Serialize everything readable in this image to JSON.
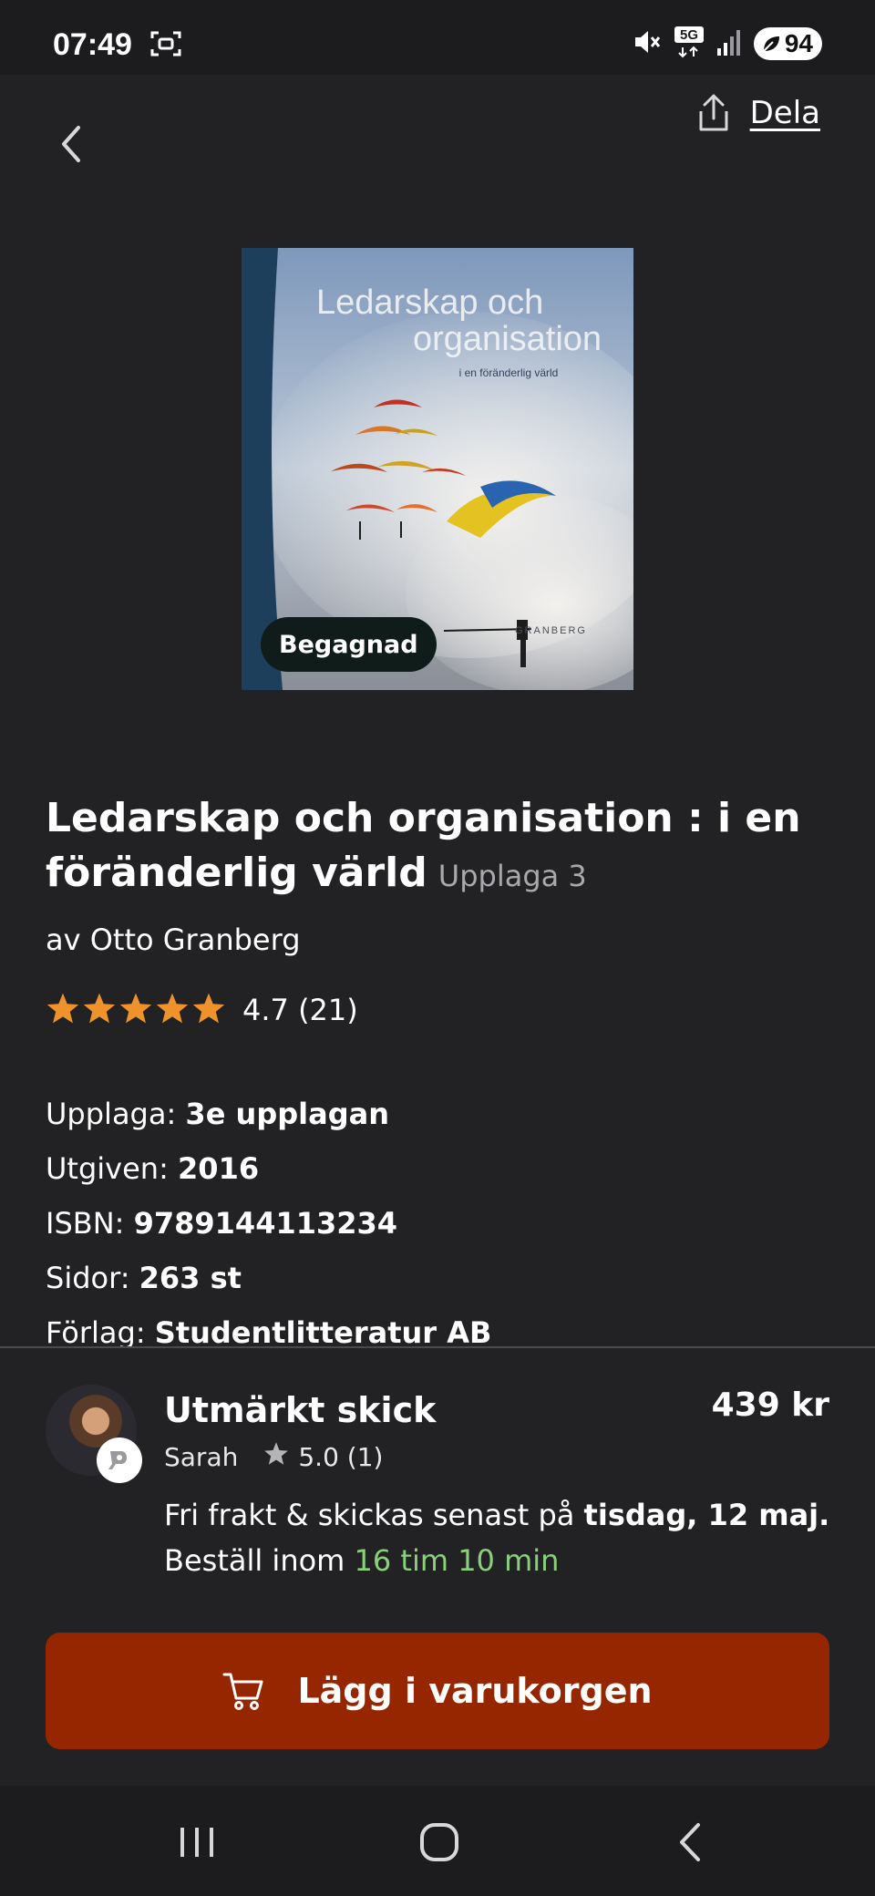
{
  "status_bar": {
    "time": "07:49",
    "battery": "94",
    "network": "5G"
  },
  "header": {
    "share_label": "Dela"
  },
  "cover": {
    "title_line1": "Ledarskap och",
    "title_line2": "organisation",
    "subtitle": "i en föränderlig värld",
    "author_mark": "GRANBERG",
    "badge": "Begagnad"
  },
  "book": {
    "title": "Ledarskap och organisation : i en föränderlig värld",
    "edition": "Upplaga 3",
    "author": "av Otto Granberg",
    "rating_value": 4.7,
    "rating_text": "4.7 (21)",
    "stars": 5
  },
  "details": {
    "upplaga_label": "Upplaga:",
    "upplaga_value": "3e upplagan",
    "utgiven_label": "Utgiven:",
    "utgiven_value": "2016",
    "isbn_label": "ISBN:",
    "isbn_value": "9789144113234",
    "sidor_label": "Sidor:",
    "sidor_value": "263 st",
    "forlag_label": "Förlag:",
    "forlag_value": "Studentlitteratur AB"
  },
  "offer": {
    "condition": "Utmärkt skick",
    "price": "439 kr",
    "seller_name": "Sarah",
    "seller_rating": "5.0 (1)",
    "shipping_prefix": "Fri frakt & skickas senast på",
    "shipping_date": "tisdag, 12 maj.",
    "order_prefix": "Beställ inom",
    "order_countdown": "16 tim 10 min"
  },
  "cta": {
    "label": "Lägg i varukorgen"
  },
  "colors": {
    "background": "#222224",
    "accent_button": "#952600",
    "star": "#f0922b",
    "countdown": "#8ad07a"
  }
}
